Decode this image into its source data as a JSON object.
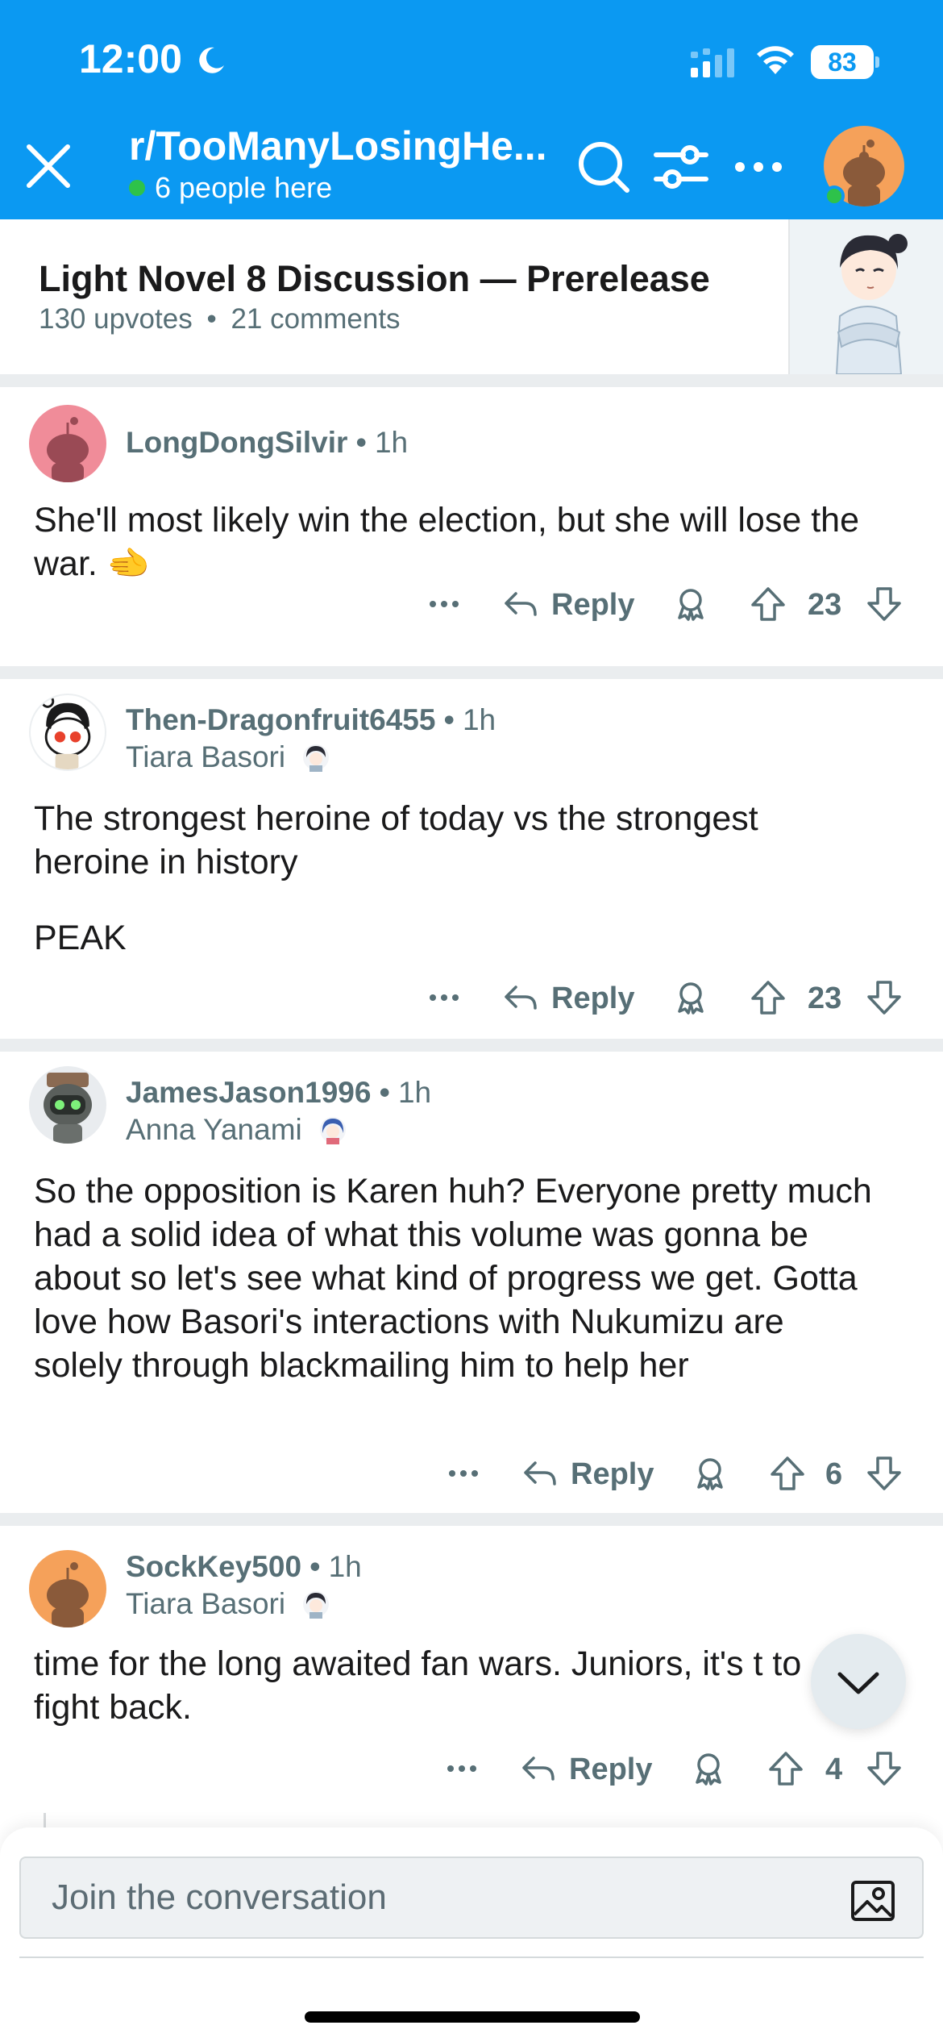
{
  "status_bar": {
    "time": "12:00",
    "battery": "83"
  },
  "header": {
    "subreddit": "r/TooManyLosingHe...",
    "presence": "6 people here",
    "accent_color": "#0b99f2"
  },
  "post": {
    "title": "Light Novel 8 Discussion — Prerelease",
    "upvotes": "130 upvotes",
    "comments": "21 comments",
    "meta_separator": "•"
  },
  "comments": [
    {
      "username": "LongDongSilvir",
      "time": "1h",
      "flair": "",
      "body": "She'll most likely win the election, but she will lose the war.",
      "body_emoji": "🫲",
      "reply_label": "Reply",
      "score": "23",
      "avatar_color": "#f08c99"
    },
    {
      "username": "Then-Dragonfruit6455",
      "time": "1h",
      "flair": "Tiara Basori",
      "body_lines": [
        "The strongest heroine of today vs the strongest heroine in history",
        "PEAK"
      ],
      "reply_label": "Reply",
      "score": "23",
      "avatar_color": "#ffffff"
    },
    {
      "username": "JamesJason1996",
      "time": "1h",
      "flair": "Anna Yanami",
      "body": "So the opposition is Karen huh? Everyone pretty much had a solid idea of what this volume was gonna be about so let's see what kind of progress we get. Gotta love how Basori's interactions with Nukumizu are solely through blackmailing him to help her",
      "reply_label": "Reply",
      "score": "6",
      "avatar_color": "#e9ecef"
    },
    {
      "username": "SockKey500",
      "time": "1h",
      "flair": "Tiara Basori",
      "body": "time for the long awaited fan wars. Juniors, it's t to fight back.",
      "reply_label": "Reply",
      "score": "4",
      "avatar_color": "#f5a15a"
    }
  ],
  "composer": {
    "placeholder": "Join the conversation"
  },
  "icons": {
    "close": "close-icon",
    "search": "search-icon",
    "filter": "filter-icon",
    "more": "more-icon",
    "reply": "reply-arrow-icon",
    "award": "award-icon",
    "upvote": "upvote-icon",
    "downvote": "downvote-icon",
    "scroll_down": "chevron-down-icon",
    "image": "image-icon"
  }
}
